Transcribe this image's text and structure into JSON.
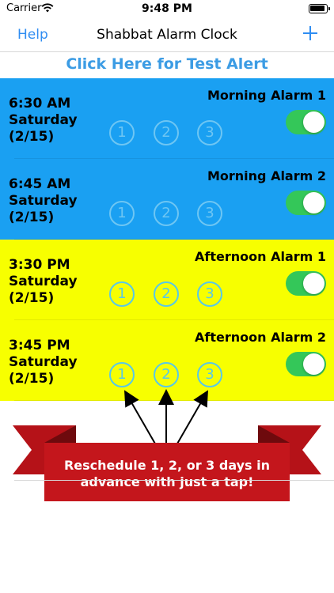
{
  "status": {
    "carrier": "Carrier",
    "time": "9:48 PM"
  },
  "nav": {
    "help": "Help",
    "title": "Shabbat Alarm Clock"
  },
  "test_alert": "Click Here for Test Alert",
  "day_labels": [
    "1",
    "2",
    "3"
  ],
  "alarms": [
    {
      "time": "6:30 AM",
      "day": "Saturday",
      "date": "(2/15)",
      "name": "Morning Alarm 1",
      "enabled": true,
      "color": "#1aa0f2"
    },
    {
      "time": "6:45 AM",
      "day": "Saturday",
      "date": "(2/15)",
      "name": "Morning Alarm 2",
      "enabled": true,
      "color": "#1aa0f2"
    },
    {
      "time": "3:30 PM",
      "day": "Saturday",
      "date": "(2/15)",
      "name": "Afternoon Alarm 1",
      "enabled": true,
      "color": "#f7ff00"
    },
    {
      "time": "3:45 PM",
      "day": "Saturday",
      "date": "(2/15)",
      "name": "Afternoon Alarm 2",
      "enabled": true,
      "color": "#f7ff00"
    }
  ],
  "ribbon": {
    "line1": "Reschedule 1, 2, or 3 days in",
    "line2": "advance with just a tap!",
    "color": "#c4161c"
  },
  "colors": {
    "accent": "#2f8df2",
    "toggle_on": "#34c759"
  }
}
